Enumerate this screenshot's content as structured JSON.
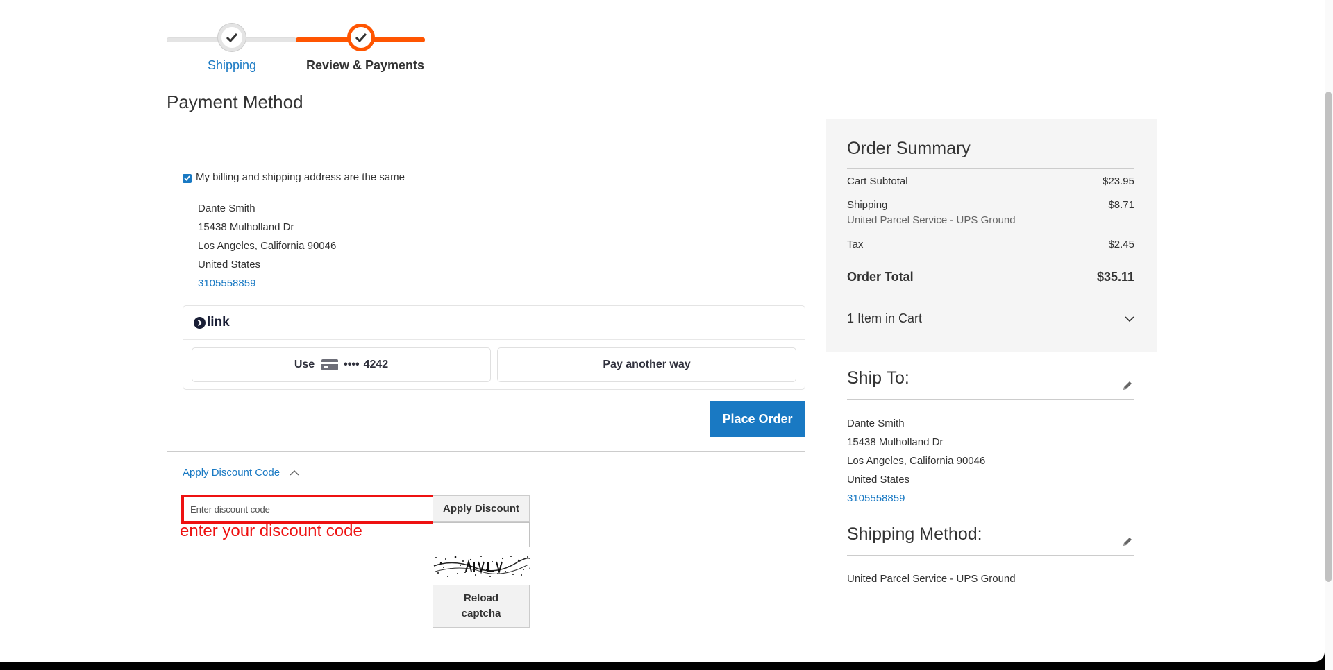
{
  "progress": {
    "steps": [
      {
        "label": "Shipping"
      },
      {
        "label": "Review & Payments"
      }
    ]
  },
  "payment": {
    "title": "Payment Method",
    "billing_same_label": "My billing and shipping address are the same",
    "billing_same_checked": true,
    "address": {
      "name": "Dante Smith",
      "street": "15438 Mulholland Dr",
      "city_line": "Los Angeles, California 90046",
      "country": "United States",
      "phone": "3105558859"
    },
    "link": {
      "brand": "link",
      "use_label": "Use",
      "card_dots": "••••",
      "card_last4": "4242",
      "pay_another": "Pay another way"
    },
    "place_order": "Place Order"
  },
  "discount": {
    "toggle_label": "Apply Discount Code",
    "input_placeholder": "Enter discount code",
    "annotation": "enter your discount code",
    "apply_label": "Apply Discount",
    "reload_label_1": "Reload",
    "reload_label_2": "captcha"
  },
  "summary": {
    "title": "Order Summary",
    "cart_subtotal_label": "Cart Subtotal",
    "cart_subtotal": "$23.95",
    "shipping_label": "Shipping",
    "shipping": "$8.71",
    "shipping_carrier": "United Parcel Service - UPS Ground",
    "tax_label": "Tax",
    "tax": "$2.45",
    "total_label": "Order Total",
    "total": "$35.11",
    "items_in_cart": "1 Item in Cart"
  },
  "ship_to": {
    "title": "Ship To:",
    "name": "Dante Smith",
    "street": "15438 Mulholland Dr",
    "city_line": "Los Angeles, California 90046",
    "country": "United States",
    "phone": "3105558859"
  },
  "shipping_method": {
    "title": "Shipping Method:",
    "value": "United Parcel Service - UPS Ground"
  },
  "colors": {
    "accent": "#1979c3",
    "progress_active": "#ff5501",
    "annotation": "#ee1111"
  }
}
